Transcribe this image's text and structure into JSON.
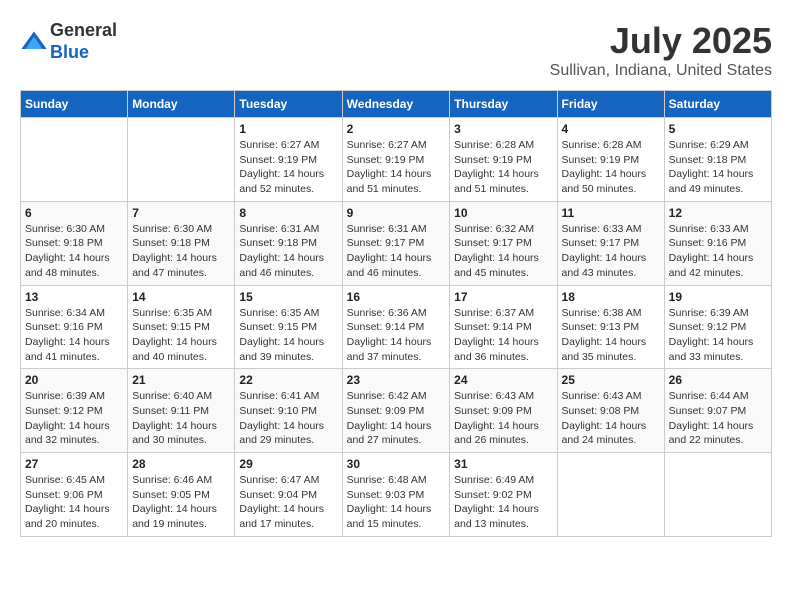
{
  "header": {
    "logo_line1": "General",
    "logo_line2": "Blue",
    "title": "July 2025",
    "subtitle": "Sullivan, Indiana, United States"
  },
  "calendar": {
    "days_of_week": [
      "Sunday",
      "Monday",
      "Tuesday",
      "Wednesday",
      "Thursday",
      "Friday",
      "Saturday"
    ],
    "weeks": [
      [
        {
          "day": "",
          "info": ""
        },
        {
          "day": "",
          "info": ""
        },
        {
          "day": "1",
          "info": "Sunrise: 6:27 AM\nSunset: 9:19 PM\nDaylight: 14 hours and 52 minutes."
        },
        {
          "day": "2",
          "info": "Sunrise: 6:27 AM\nSunset: 9:19 PM\nDaylight: 14 hours and 51 minutes."
        },
        {
          "day": "3",
          "info": "Sunrise: 6:28 AM\nSunset: 9:19 PM\nDaylight: 14 hours and 51 minutes."
        },
        {
          "day": "4",
          "info": "Sunrise: 6:28 AM\nSunset: 9:19 PM\nDaylight: 14 hours and 50 minutes."
        },
        {
          "day": "5",
          "info": "Sunrise: 6:29 AM\nSunset: 9:18 PM\nDaylight: 14 hours and 49 minutes."
        }
      ],
      [
        {
          "day": "6",
          "info": "Sunrise: 6:30 AM\nSunset: 9:18 PM\nDaylight: 14 hours and 48 minutes."
        },
        {
          "day": "7",
          "info": "Sunrise: 6:30 AM\nSunset: 9:18 PM\nDaylight: 14 hours and 47 minutes."
        },
        {
          "day": "8",
          "info": "Sunrise: 6:31 AM\nSunset: 9:18 PM\nDaylight: 14 hours and 46 minutes."
        },
        {
          "day": "9",
          "info": "Sunrise: 6:31 AM\nSunset: 9:17 PM\nDaylight: 14 hours and 46 minutes."
        },
        {
          "day": "10",
          "info": "Sunrise: 6:32 AM\nSunset: 9:17 PM\nDaylight: 14 hours and 45 minutes."
        },
        {
          "day": "11",
          "info": "Sunrise: 6:33 AM\nSunset: 9:17 PM\nDaylight: 14 hours and 43 minutes."
        },
        {
          "day": "12",
          "info": "Sunrise: 6:33 AM\nSunset: 9:16 PM\nDaylight: 14 hours and 42 minutes."
        }
      ],
      [
        {
          "day": "13",
          "info": "Sunrise: 6:34 AM\nSunset: 9:16 PM\nDaylight: 14 hours and 41 minutes."
        },
        {
          "day": "14",
          "info": "Sunrise: 6:35 AM\nSunset: 9:15 PM\nDaylight: 14 hours and 40 minutes."
        },
        {
          "day": "15",
          "info": "Sunrise: 6:35 AM\nSunset: 9:15 PM\nDaylight: 14 hours and 39 minutes."
        },
        {
          "day": "16",
          "info": "Sunrise: 6:36 AM\nSunset: 9:14 PM\nDaylight: 14 hours and 37 minutes."
        },
        {
          "day": "17",
          "info": "Sunrise: 6:37 AM\nSunset: 9:14 PM\nDaylight: 14 hours and 36 minutes."
        },
        {
          "day": "18",
          "info": "Sunrise: 6:38 AM\nSunset: 9:13 PM\nDaylight: 14 hours and 35 minutes."
        },
        {
          "day": "19",
          "info": "Sunrise: 6:39 AM\nSunset: 9:12 PM\nDaylight: 14 hours and 33 minutes."
        }
      ],
      [
        {
          "day": "20",
          "info": "Sunrise: 6:39 AM\nSunset: 9:12 PM\nDaylight: 14 hours and 32 minutes."
        },
        {
          "day": "21",
          "info": "Sunrise: 6:40 AM\nSunset: 9:11 PM\nDaylight: 14 hours and 30 minutes."
        },
        {
          "day": "22",
          "info": "Sunrise: 6:41 AM\nSunset: 9:10 PM\nDaylight: 14 hours and 29 minutes."
        },
        {
          "day": "23",
          "info": "Sunrise: 6:42 AM\nSunset: 9:09 PM\nDaylight: 14 hours and 27 minutes."
        },
        {
          "day": "24",
          "info": "Sunrise: 6:43 AM\nSunset: 9:09 PM\nDaylight: 14 hours and 26 minutes."
        },
        {
          "day": "25",
          "info": "Sunrise: 6:43 AM\nSunset: 9:08 PM\nDaylight: 14 hours and 24 minutes."
        },
        {
          "day": "26",
          "info": "Sunrise: 6:44 AM\nSunset: 9:07 PM\nDaylight: 14 hours and 22 minutes."
        }
      ],
      [
        {
          "day": "27",
          "info": "Sunrise: 6:45 AM\nSunset: 9:06 PM\nDaylight: 14 hours and 20 minutes."
        },
        {
          "day": "28",
          "info": "Sunrise: 6:46 AM\nSunset: 9:05 PM\nDaylight: 14 hours and 19 minutes."
        },
        {
          "day": "29",
          "info": "Sunrise: 6:47 AM\nSunset: 9:04 PM\nDaylight: 14 hours and 17 minutes."
        },
        {
          "day": "30",
          "info": "Sunrise: 6:48 AM\nSunset: 9:03 PM\nDaylight: 14 hours and 15 minutes."
        },
        {
          "day": "31",
          "info": "Sunrise: 6:49 AM\nSunset: 9:02 PM\nDaylight: 14 hours and 13 minutes."
        },
        {
          "day": "",
          "info": ""
        },
        {
          "day": "",
          "info": ""
        }
      ]
    ]
  }
}
